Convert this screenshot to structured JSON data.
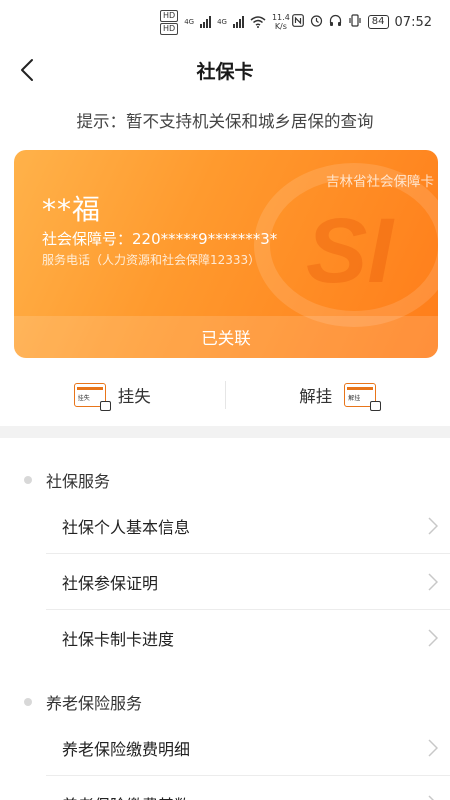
{
  "status_bar": {
    "sim1": "HD",
    "sim2": "HD",
    "net1": "4G",
    "net2": "4G",
    "speed_value": "11.4",
    "speed_unit": "K/s",
    "battery": "84",
    "time": "07:52",
    "icons": [
      "nfc-icon",
      "alarm-icon",
      "headphones-icon",
      "vibrate-icon"
    ]
  },
  "header": {
    "title": "社保卡",
    "back_icon": "chevron-left-icon"
  },
  "hint": "提示：暂不支持机关保和城乡居保的查询",
  "card": {
    "province": "吉林省社会保障卡",
    "name": "**福",
    "number_label": "社会保障号：",
    "number": "220*****9*******3*",
    "service_phone": "服务电话（人力资源和社会保障12333）",
    "status": "已关联",
    "gradient_start": "#ffb24a",
    "gradient_end": "#ff7d1a"
  },
  "actions": {
    "report_loss_label": "挂失",
    "report_loss_icon_text": "挂失",
    "unfreeze_label": "解挂",
    "unfreeze_icon_text": "解挂",
    "accent": "#e8751a"
  },
  "sections": [
    {
      "title": "社保服务",
      "items": [
        {
          "label": "社保个人基本信息"
        },
        {
          "label": "社保参保证明"
        },
        {
          "label": "社保卡制卡进度"
        }
      ]
    },
    {
      "title": "养老保险服务",
      "items": [
        {
          "label": "养老保险缴费明细"
        },
        {
          "label": "养老保险缴费基数"
        }
      ]
    }
  ]
}
